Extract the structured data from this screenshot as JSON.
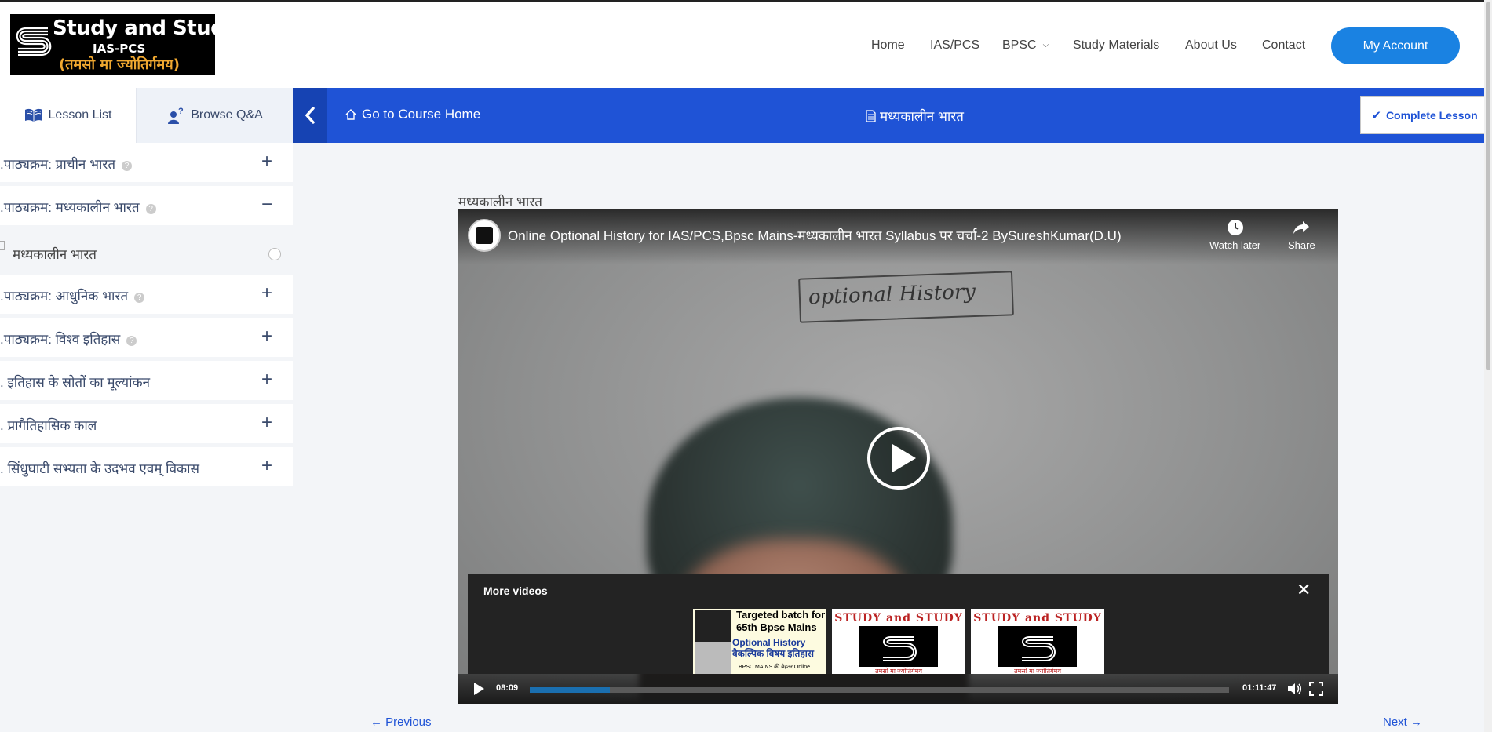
{
  "logo": {
    "line1": "Study and Study",
    "line2": "IAS-PCS",
    "line3": "(तमसो मा ज्योतिर्गमय)"
  },
  "nav": {
    "items": [
      "Home",
      "IAS/PCS",
      "BPSC",
      "Study Materials",
      "About Us",
      "Contact"
    ],
    "account": "My Account"
  },
  "sidebar": {
    "tabs": [
      "Lesson List",
      "Browse Q&A"
    ],
    "sections": [
      {
        "title": ".पाठ्यक्रम: प्राचीन भारत",
        "toggle": "+"
      },
      {
        "title": ".पाठ्यक्रम: मध्यकालीन भारत",
        "toggle": "−"
      },
      {
        "title": ".पाठ्यक्रम: आधुनिक भारत",
        "toggle": "+"
      },
      {
        "title": ".पाठ्यक्रम: विश्व इतिहास",
        "toggle": "+"
      },
      {
        "title": ". इतिहास के स्रोतों का मूल्यांकन",
        "toggle": "+"
      },
      {
        "title": ". प्रागैतिहासिक काल",
        "toggle": "+"
      },
      {
        "title": ". सिंधुघाटी सभ्यता के उदभव एवम् विकास",
        "toggle": "+"
      }
    ],
    "subitem": "मध्यकालीन भारत"
  },
  "bar": {
    "course_home": "Go to Course Home",
    "lesson_title": "मध्यकालीन भारत",
    "complete": "Complete Lesson"
  },
  "content": {
    "title": "मध्यकालीन भारत",
    "video": {
      "title": "Online Optional History for IAS/PCS,Bpsc Mains-मध्यकालीन भारत Syllabus पर चर्चा-2 BySureshKumar(D.U)",
      "watch_later": "Watch later",
      "share": "Share",
      "board_text": "optional History",
      "more_videos": "More videos",
      "thumb1": {
        "line1": "Targeted batch for",
        "line2": "65th Bpsc Mains",
        "line3": "Optional History",
        "line4": "वैकल्पिक विषय इतिहास",
        "line5": "BPSC MAINS की बेहतर Online"
      },
      "thumb2": {
        "head": "STUDY and STUDY",
        "foot": "तमसो मा ज्योतिर्गमय"
      },
      "thumb3": {
        "head": "STUDY and STUDY",
        "foot": "तमसो मा ज्योतिर्गमय"
      },
      "current_time": "08:09",
      "duration": "01:11:47",
      "progress_fraction": 0.114
    },
    "prev": "← Previous",
    "next": "Next →"
  },
  "colors": {
    "accent": "#1f53d6",
    "account_button": "#1a82e2",
    "progress": "#1a6fb0"
  }
}
